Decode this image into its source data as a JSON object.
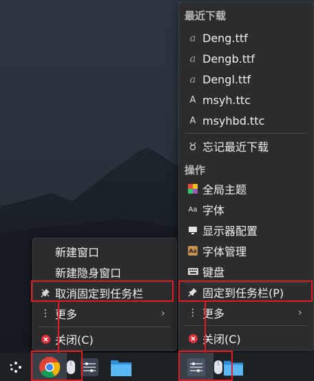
{
  "left_menu": {
    "items": [
      {
        "label": "新建窗口"
      },
      {
        "label": "新建隐身窗口"
      },
      {
        "label": "取消固定到任务栏"
      },
      {
        "label": "更多"
      },
      {
        "label": "关闭(C)"
      }
    ]
  },
  "right_menu": {
    "recent_header": "最近下载",
    "recent_files": [
      {
        "icon": "a",
        "label": "Deng.ttf"
      },
      {
        "icon": "a",
        "label": "Dengb.ttf"
      },
      {
        "icon": "a",
        "label": "Dengl.ttf"
      },
      {
        "icon": "A",
        "label": "msyh.ttc"
      },
      {
        "icon": "A",
        "label": "msyhbd.ttc"
      }
    ],
    "forget_label": "忘记最近下载",
    "actions_header": "操作",
    "actions": [
      {
        "label": "全局主题",
        "icon": "theme-icon"
      },
      {
        "label": "字体",
        "icon_text": "Aa"
      },
      {
        "label": "显示器配置",
        "icon": "monitor-icon"
      },
      {
        "label": "字体管理",
        "icon_text": "Aa"
      },
      {
        "label": "键盘",
        "icon": "keyboard-icon"
      }
    ],
    "pin_label": "固定到任务栏(P)",
    "more_label": "更多",
    "close_label": "关闭(C)"
  },
  "colors": {
    "highlight": "#e01b24",
    "menu_bg": "#2b2c2e",
    "close_icon": "#e5303a"
  }
}
